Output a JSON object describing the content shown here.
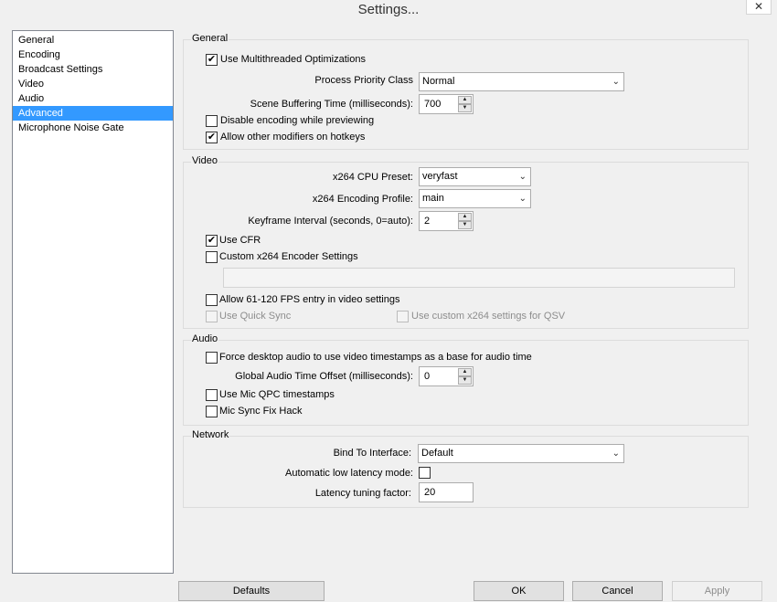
{
  "window": {
    "title": "Settings...",
    "close_glyph": "✕"
  },
  "nav": {
    "items": [
      {
        "label": "General"
      },
      {
        "label": "Encoding"
      },
      {
        "label": "Broadcast Settings"
      },
      {
        "label": "Video"
      },
      {
        "label": "Audio"
      },
      {
        "label": "Advanced"
      },
      {
        "label": "Microphone Noise Gate"
      }
    ],
    "selected": "Advanced"
  },
  "general": {
    "title": "General",
    "multithreaded": {
      "label": "Use Multithreaded Optimizations",
      "checked": true
    },
    "priority": {
      "label": "Process Priority Class",
      "value": "Normal"
    },
    "buffering": {
      "label": "Scene Buffering Time (milliseconds):",
      "value": "700"
    },
    "disable_preview": {
      "label": "Disable encoding while previewing",
      "checked": false
    },
    "modifiers": {
      "label": "Allow other modifiers on hotkeys",
      "checked": true
    }
  },
  "video": {
    "title": "Video",
    "preset": {
      "label": "x264 CPU Preset:",
      "value": "veryfast"
    },
    "profile": {
      "label": "x264 Encoding Profile:",
      "value": "main"
    },
    "keyframe": {
      "label": "Keyframe Interval (seconds, 0=auto):",
      "value": "2"
    },
    "cfr": {
      "label": "Use CFR",
      "checked": true
    },
    "custom_x264": {
      "label": "Custom x264 Encoder Settings",
      "checked": false,
      "value": ""
    },
    "fps_entry": {
      "label": "Allow 61-120 FPS entry in video settings",
      "checked": false
    },
    "quick_sync": {
      "label": "Use Quick Sync",
      "checked": false,
      "enabled": false
    },
    "qsv_custom": {
      "label": "Use custom x264 settings for QSV",
      "checked": false,
      "enabled": false
    }
  },
  "audio": {
    "title": "Audio",
    "force_desktop": {
      "label": "Force desktop audio to use video timestamps as a base for audio time",
      "checked": false
    },
    "offset": {
      "label": "Global Audio Time Offset (milliseconds):",
      "value": "0"
    },
    "mic_qpc": {
      "label": "Use Mic QPC timestamps",
      "checked": false
    },
    "mic_sync": {
      "label": "Mic Sync Fix Hack",
      "checked": false
    }
  },
  "network": {
    "title": "Network",
    "bind": {
      "label": "Bind To Interface:",
      "value": "Default"
    },
    "low_latency": {
      "label": "Automatic low latency mode:",
      "checked": false
    },
    "latency_factor": {
      "label": "Latency tuning factor:",
      "value": "20"
    }
  },
  "buttons": {
    "defaults": "Defaults",
    "ok": "OK",
    "cancel": "Cancel",
    "apply": "Apply",
    "apply_enabled": false
  },
  "glyphs": {
    "check": "✔",
    "dropdown": "⌄",
    "spin_up": "▲",
    "spin_down": "▼"
  },
  "colors": {
    "selection": "#3399ff",
    "window_bg": "#f0f0f0"
  }
}
